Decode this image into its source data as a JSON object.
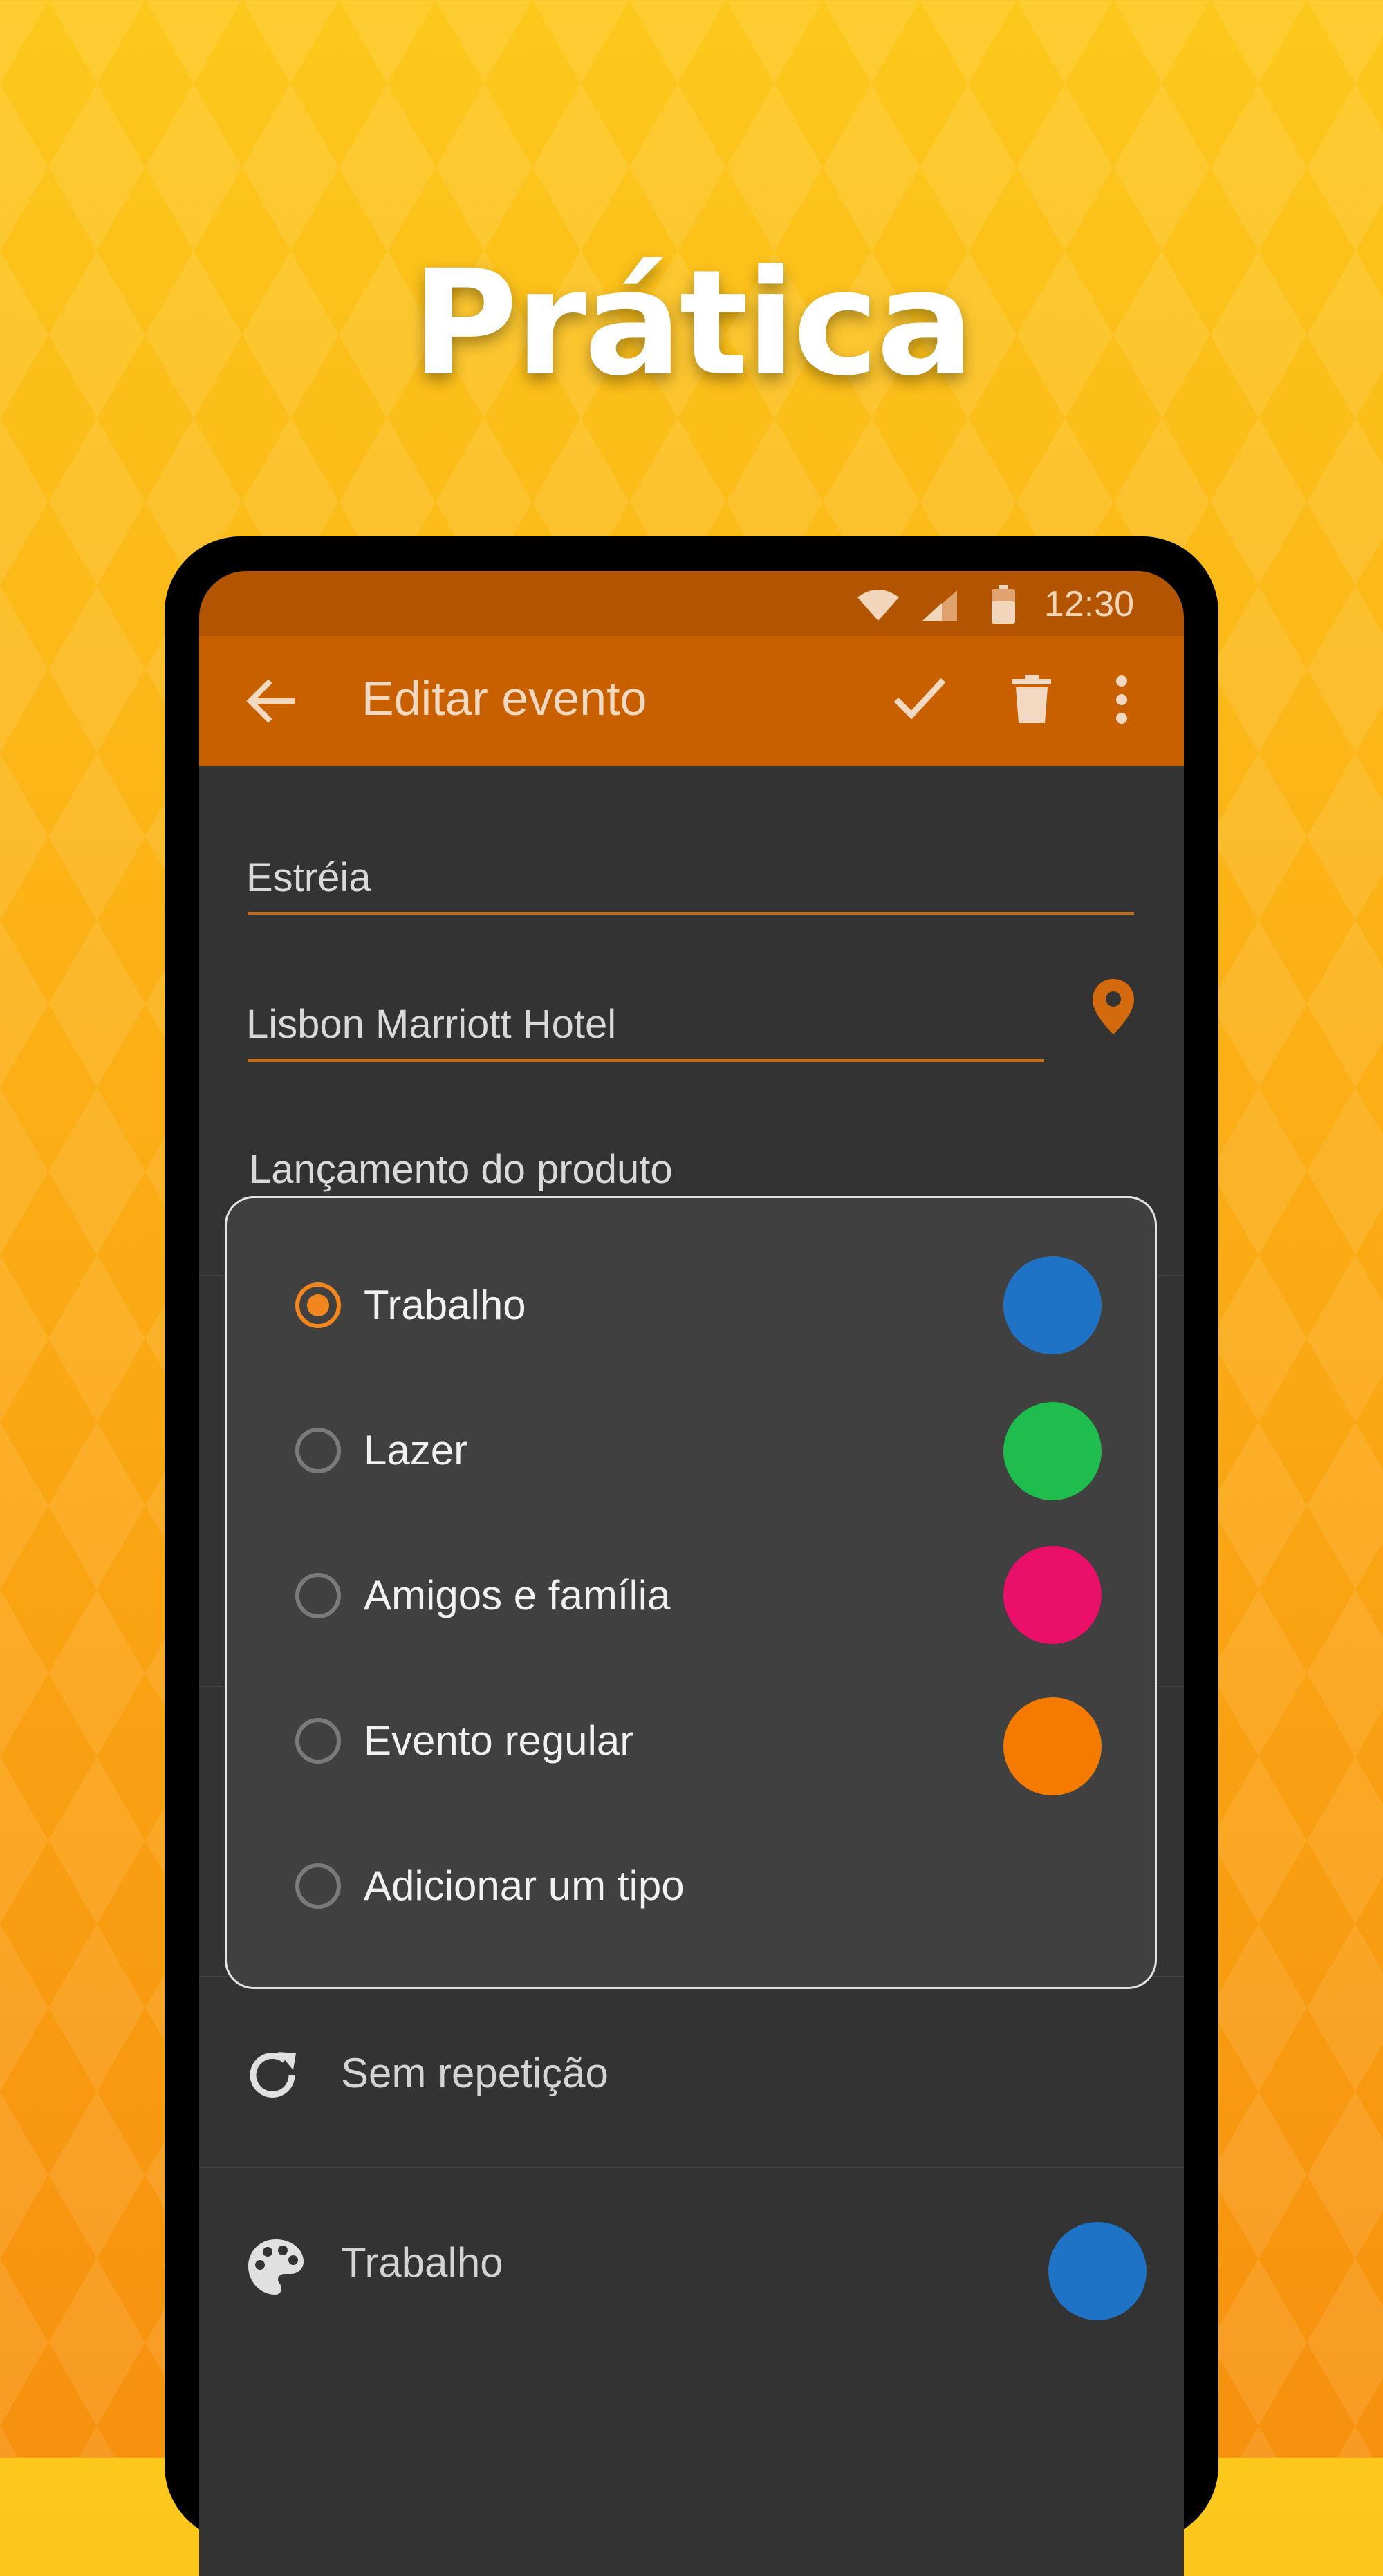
{
  "promo": {
    "headline": "Prática"
  },
  "status_bar": {
    "time": "12:30"
  },
  "app_bar": {
    "title": "Editar evento"
  },
  "form": {
    "title_value": "Estréia",
    "location_value": "Lisbon Marriott Hotel",
    "description_value": "Lançamento do produto",
    "repeat_label": "Sem repetição",
    "event_type_label": "Trabalho",
    "event_type_color": "#1F73C7"
  },
  "type_dialog": {
    "options": [
      {
        "label": "Trabalho",
        "selected": true,
        "color": "#1F73C7"
      },
      {
        "label": "Lazer",
        "selected": false,
        "color": "#1EBD4E"
      },
      {
        "label": "Amigos e família",
        "selected": false,
        "color": "#EA0F68"
      },
      {
        "label": "Evento regular",
        "selected": false,
        "color": "#F57A00"
      },
      {
        "label": "Adicionar um tipo",
        "selected": false,
        "color": null
      }
    ]
  },
  "colors": {
    "accent": "#F2861E",
    "app_bar": "#C86000",
    "status_bar": "#B35400",
    "surface": "#333333"
  },
  "icons": [
    "wifi-icon",
    "signal-icon",
    "battery-icon",
    "back-arrow-icon",
    "check-icon",
    "trash-icon",
    "more-vert-icon",
    "location-pin-icon",
    "repeat-icon",
    "palette-icon"
  ]
}
